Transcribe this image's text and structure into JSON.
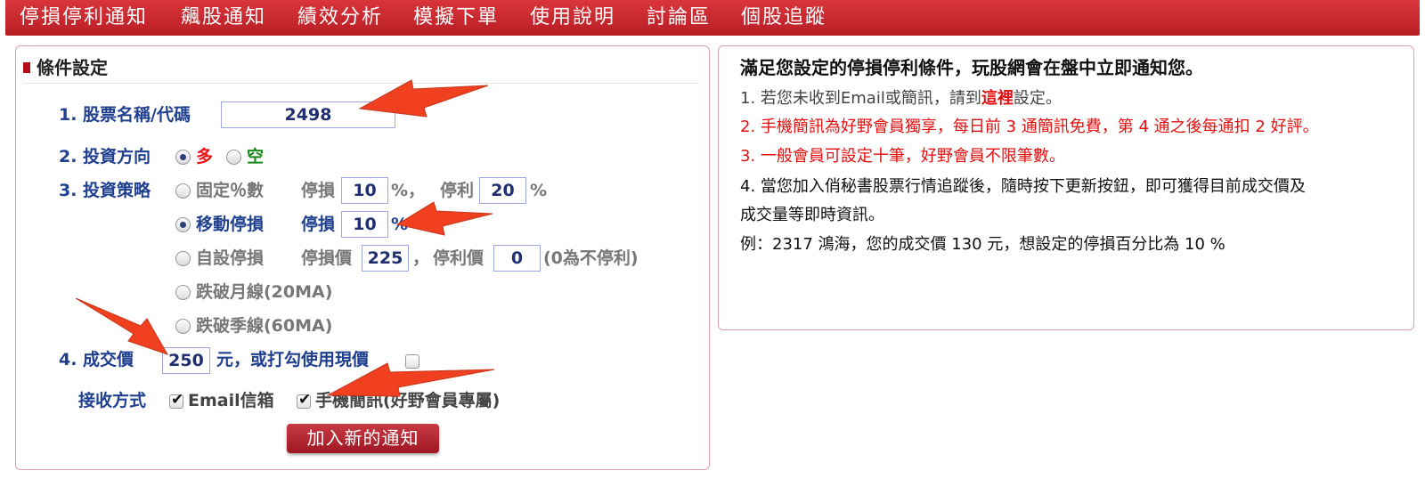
{
  "nav": {
    "items": [
      "停損停利通知",
      "飆股通知",
      "績效分析",
      "模擬下單",
      "使用說明",
      "討論區",
      "個股追蹤"
    ]
  },
  "form": {
    "section_title": "條件設定",
    "stock_label": "1. 股票名稱/代碼",
    "stock_value": "2498",
    "direction_label": "2. 投資方向",
    "direction_long": "多",
    "direction_short": "空",
    "direction_selected": "多",
    "strategy_label": "3. 投資策略",
    "strategies": {
      "fixed_pct": {
        "label": "固定％數",
        "stop_loss_label": "停損",
        "stop_loss_value": "10",
        "pct_sep": "%，",
        "take_profit_label": "停利",
        "take_profit_value": "20",
        "pct": "%"
      },
      "moving_stop": {
        "label": "移動停損",
        "stop_loss_label": "停損",
        "stop_loss_value": "10",
        "pct": "%"
      },
      "custom_stop": {
        "label": "自設停損",
        "stop_price_label": "停損價",
        "stop_price_value": "225",
        "sep": "，",
        "take_price_label": "停利價",
        "take_price_value": "0",
        "note": "(0為不停利)"
      },
      "break_monthly": "跌破月線(20MA)",
      "break_quarterly": "跌破季線(60MA)",
      "selected": "移動停損"
    },
    "price_label": "4. 成交價",
    "price_value": "250",
    "price_suffix": "元，或打勾使用現價",
    "use_current_price": false,
    "receive_label": "接收方式",
    "receive_email": "Email信箱",
    "receive_email_checked": true,
    "receive_sms": "手機簡訊(好野會員專屬)",
    "receive_sms_checked": true,
    "add_button": "加入新的通知"
  },
  "info": {
    "title": "滿足您設定的停損停利條件，玩股網會在盤中立即通知您。",
    "line1_pre": "1. 若您未收到Email或簡訊，請到",
    "line1_link": "這裡",
    "line1_post": "設定。",
    "line2": "2. 手機簡訊為好野會員獨享，每日前 3 通簡訊免費，第 4 通之後每通扣 2 好評。",
    "line3": "3. 一般會員可設定十筆，好野會員不限筆數。",
    "line4a": "4. 當您加入俏秘書股票行情追蹤後，隨時按下更新按鈕，即可獲得目前成交價及",
    "line4b": "成交量等即時資訊。",
    "example": "例：2317 鴻海，您的成交價 130 元，想設定的停損百分比為 10 %"
  },
  "colors": {
    "nav_bg": "#c52a31",
    "label_blue": "#1f3f8f",
    "alert_red": "#e50f0f",
    "arrow": "#f0401f"
  }
}
